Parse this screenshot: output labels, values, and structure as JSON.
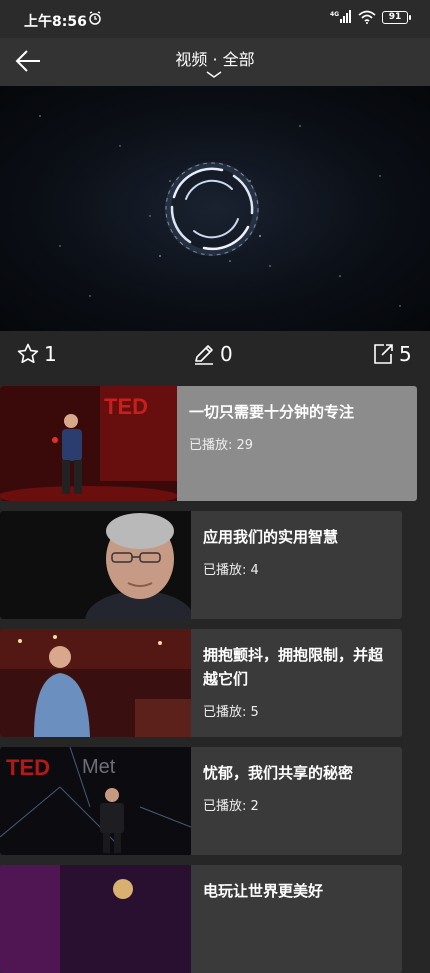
{
  "status": {
    "time": "上午8:56",
    "battery": "91",
    "network": "4G"
  },
  "header": {
    "title": "视频 · 全部"
  },
  "actions": {
    "favorites": "1",
    "comments": "0",
    "shares": "5"
  },
  "videos": [
    {
      "title": "一切只需要十分钟的专注",
      "plays": "已播放: 29"
    },
    {
      "title": "应用我们的实用智慧",
      "plays": "已播放: 4"
    },
    {
      "title": "拥抱颤抖，拥抱限制，并超越它们",
      "plays": "已播放: 5"
    },
    {
      "title": "忧郁，我们共享的秘密",
      "plays": "已播放: 2"
    },
    {
      "title": "电玩让世界更美好",
      "plays": ""
    }
  ],
  "thumb_texts": {
    "ted": "TED",
    "met": "Met"
  }
}
